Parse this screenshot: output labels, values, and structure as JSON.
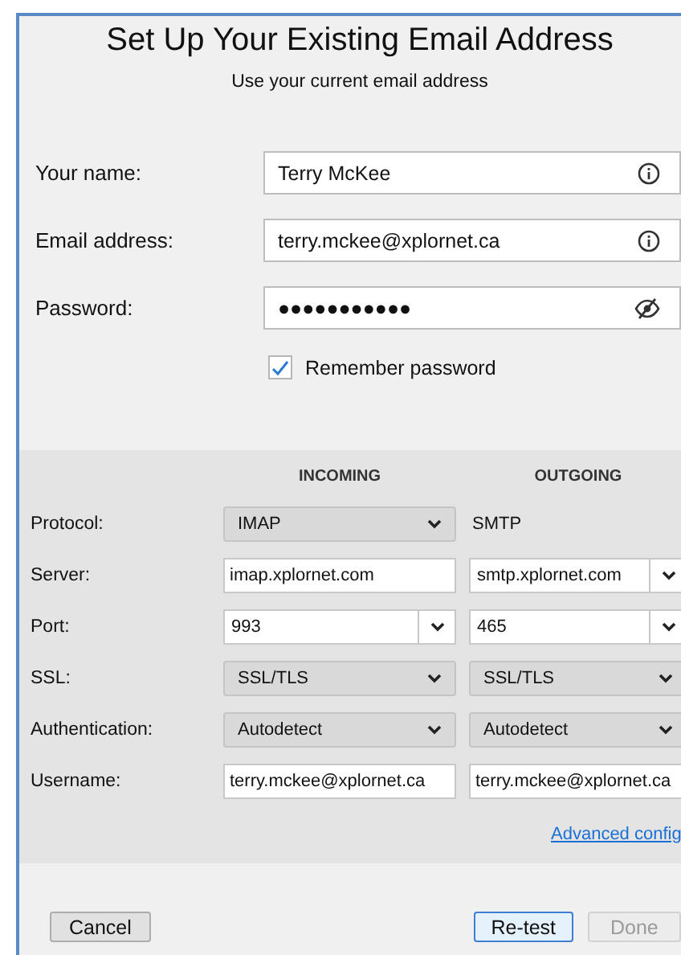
{
  "dialog": {
    "title": "Set Up Your Existing Email Address",
    "subtitle": "Use your current email address"
  },
  "fields": [
    {
      "label": "Your name:",
      "value": "Terry McKee",
      "kind": "info"
    },
    {
      "label": "Email address:",
      "value": "terry.mckee@xplornet.ca",
      "kind": "info"
    },
    {
      "label": "Password:",
      "value": "●●●●●●●●●●●",
      "kind": "password"
    }
  ],
  "remember_password": {
    "label": "Remember password",
    "checked": true
  },
  "server_settings": {
    "columns": [
      "INCOMING",
      "OUTGOING"
    ],
    "rows": [
      {
        "label": "Protocol:",
        "incoming": {
          "kind": "dropdown",
          "value": "IMAP"
        },
        "outgoing": {
          "kind": "text",
          "value": "SMTP"
        }
      },
      {
        "label": "Server:",
        "incoming": {
          "kind": "input",
          "value": "imap.xplornet.com"
        },
        "outgoing": {
          "kind": "combo",
          "value": "smtp.xplornet.com"
        }
      },
      {
        "label": "Port:",
        "incoming": {
          "kind": "combo",
          "value": "993"
        },
        "outgoing": {
          "kind": "combo",
          "value": "465"
        }
      },
      {
        "label": "SSL:",
        "incoming": {
          "kind": "dropdown",
          "value": "SSL/TLS"
        },
        "outgoing": {
          "kind": "dropdown",
          "value": "SSL/TLS"
        }
      },
      {
        "label": "Authentication:",
        "incoming": {
          "kind": "dropdown",
          "value": "Autodetect"
        },
        "outgoing": {
          "kind": "dropdown",
          "value": "Autodetect"
        }
      },
      {
        "label": "Username:",
        "incoming": {
          "kind": "input",
          "value": "terry.mckee@xplornet.ca"
        },
        "outgoing": {
          "kind": "input",
          "value": "terry.mckee@xplornet.ca"
        }
      }
    ],
    "advanced_link": "Advanced config"
  },
  "buttons": [
    {
      "label": "Cancel",
      "default": false,
      "disabled": false
    },
    {
      "label": "Re-test",
      "default": true,
      "disabled": false
    },
    {
      "label": "Done",
      "default": false,
      "disabled": true
    }
  ]
}
